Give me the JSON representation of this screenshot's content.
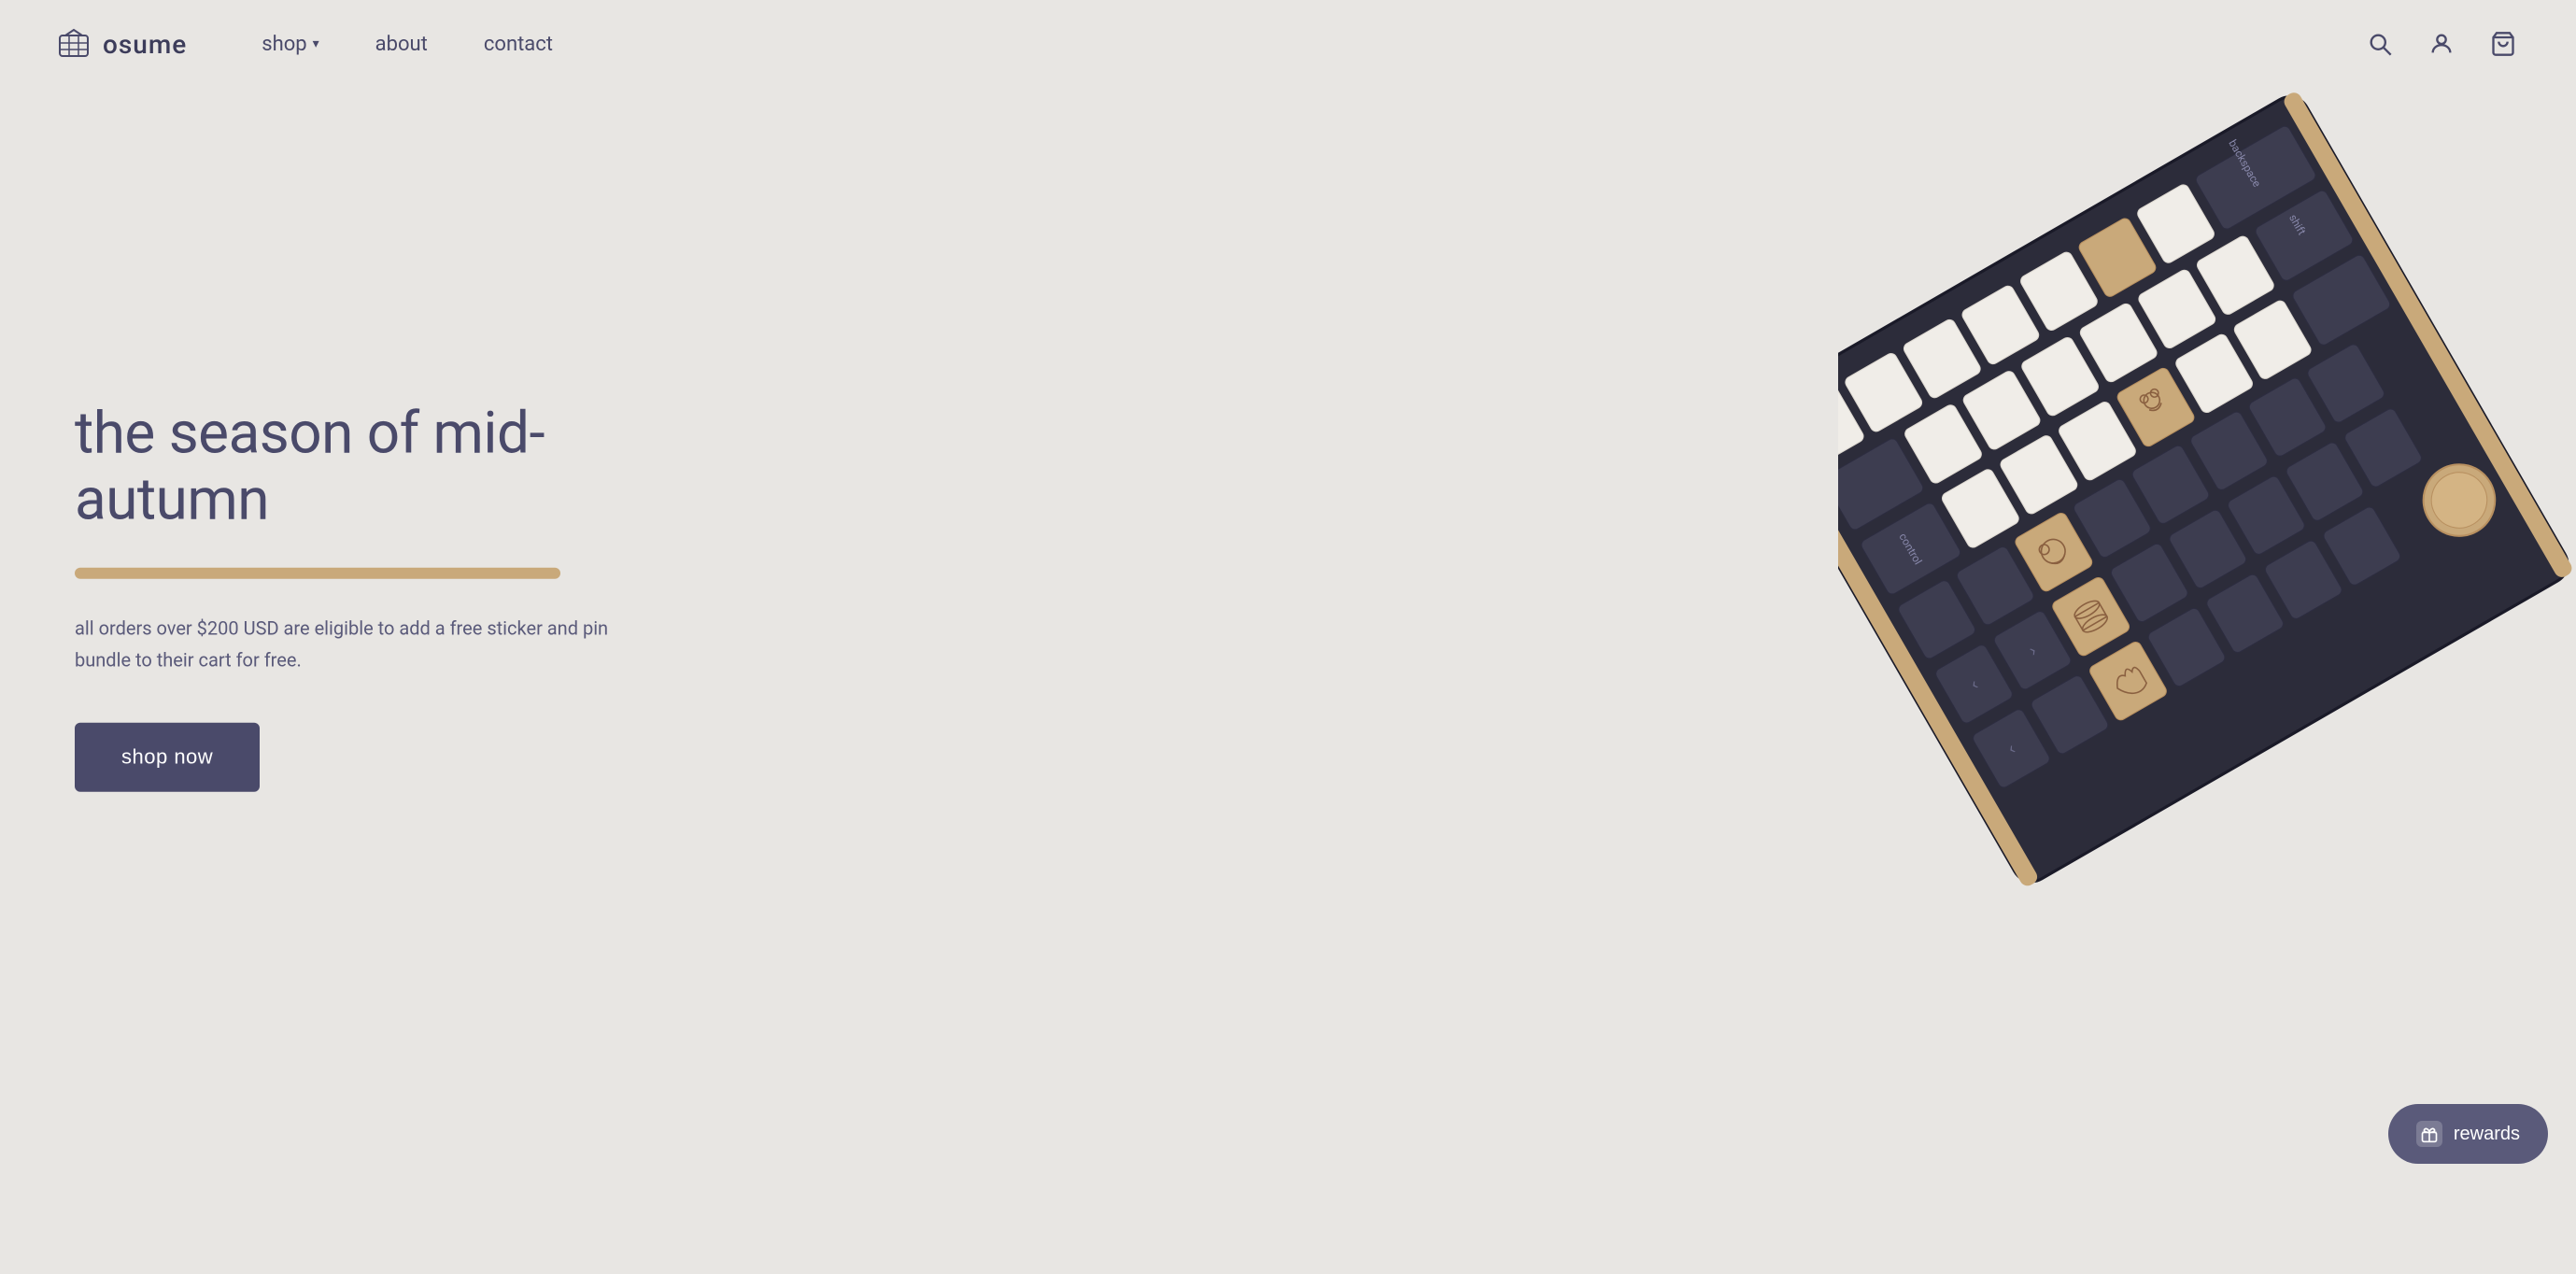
{
  "brand": {
    "name": "osume",
    "logo_alt": "osume logo"
  },
  "nav": {
    "shop_label": "shop",
    "about_label": "about",
    "contact_label": "contact",
    "search_icon": "search-icon",
    "account_icon": "account-icon",
    "cart_icon": "cart-icon"
  },
  "hero": {
    "title": "the season of mid-autumn",
    "description": "all orders over $200 USD are eligible to add a free sticker and pin bundle to their cart for free.",
    "cta_label": "shop now"
  },
  "rewards": {
    "label": "rewards"
  },
  "colors": {
    "accent": "#c9a97a",
    "primary_dark": "#4a4a6a",
    "bg": "#e8e6e3"
  }
}
